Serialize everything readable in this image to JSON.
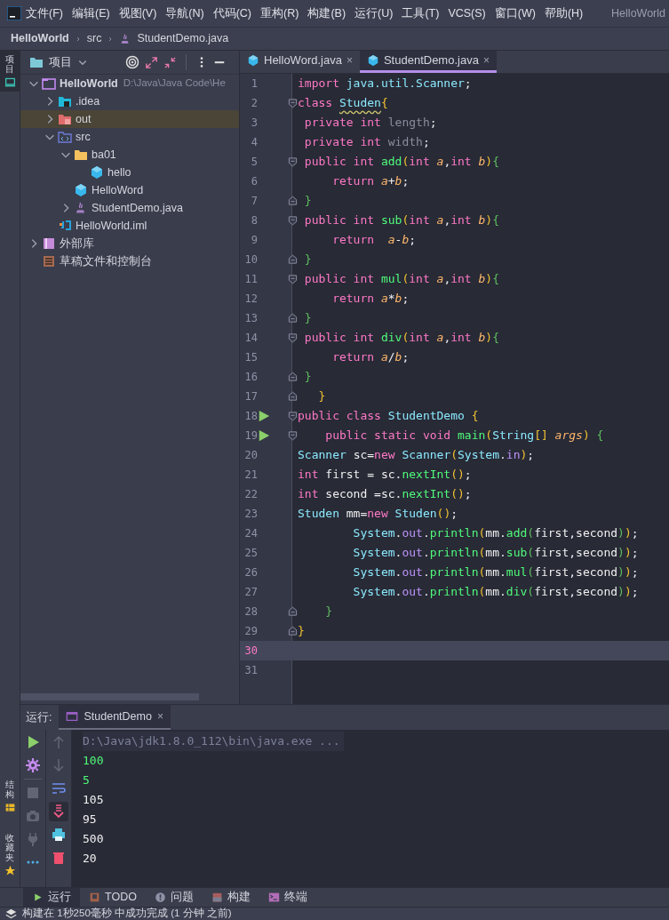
{
  "menu": {
    "items": [
      "文件(F)",
      "编辑(E)",
      "视图(V)",
      "导航(N)",
      "代码(C)",
      "重构(R)",
      "构建(B)",
      "运行(U)",
      "工具(T)",
      "VCS(S)",
      "窗口(W)",
      "帮助(H)"
    ],
    "title": "HelloWorld"
  },
  "breadcrumb": [
    {
      "text": "HelloWorld",
      "kind": "project"
    },
    {
      "text": "src",
      "kind": "folder"
    },
    {
      "text": "StudentDemo.java",
      "kind": "java"
    }
  ],
  "side_strip": [
    {
      "label": "项目",
      "kind": "project",
      "selected": true
    },
    {
      "label": "结构",
      "kind": "structure",
      "selected": false
    },
    {
      "label": "收藏夹",
      "kind": "favorites",
      "selected": false
    }
  ],
  "project_panel": {
    "title": "项目",
    "tree": [
      {
        "label": "HelloWorld",
        "path": "D:\\Java\\Java Code\\He",
        "kind": "module",
        "expanded": true,
        "selected": false,
        "children": [
          {
            "label": ".idea",
            "kind": "idea",
            "expanded": false,
            "selected": false
          },
          {
            "label": "out",
            "kind": "excluded",
            "expanded": false,
            "selected": true
          },
          {
            "label": "src",
            "kind": "source",
            "expanded": true,
            "selected": false,
            "children": [
              {
                "label": "ba01",
                "kind": "package",
                "expanded": true,
                "selected": false,
                "children": [
                  {
                    "label": "hello",
                    "kind": "class",
                    "selected": false
                  }
                ]
              },
              {
                "label": "HelloWord",
                "kind": "class",
                "selected": false
              },
              {
                "label": "StudentDemo.java",
                "kind": "java",
                "expanded": false,
                "selected": false
              }
            ]
          },
          {
            "label": "HelloWorld.iml",
            "kind": "iml",
            "selected": false
          }
        ]
      },
      {
        "label": "外部库",
        "kind": "library",
        "expanded": false,
        "selected": false
      },
      {
        "label": "草稿文件和控制台",
        "kind": "scratch",
        "selected": false
      }
    ]
  },
  "editor": {
    "tabs": [
      {
        "label": "HelloWord.java",
        "close": "×",
        "selected": false
      },
      {
        "label": "StudentDemo.java",
        "close": "×",
        "selected": true
      }
    ],
    "lines": [
      {
        "number": "1",
        "run": false,
        "fold_open": false,
        "fold_close": false,
        "current": false,
        "tokens": [
          {
            "kind": "kw",
            "text": "import "
          },
          {
            "kind": "type",
            "text": "java.util.Scanner"
          },
          {
            "kind": "plain",
            "text": ";"
          }
        ]
      },
      {
        "number": "2",
        "run": false,
        "fold_open": true,
        "fold_close": false,
        "current": false,
        "tokens": [
          {
            "kind": "kw",
            "text": "class "
          },
          {
            "kind": "type",
            "text": "Studen",
            "warn": true
          },
          {
            "kind": "b1",
            "text": "{"
          }
        ]
      },
      {
        "number": "3",
        "run": false,
        "fold_open": false,
        "fold_close": false,
        "current": false,
        "tokens": [
          {
            "kind": "kw",
            "text": " private int "
          },
          {
            "kind": "unused",
            "text": "length"
          },
          {
            "kind": "plain",
            "text": ";"
          }
        ]
      },
      {
        "number": "4",
        "run": false,
        "fold_open": false,
        "fold_close": false,
        "current": false,
        "tokens": [
          {
            "kind": "kw",
            "text": " private int "
          },
          {
            "kind": "unused",
            "text": "width"
          },
          {
            "kind": "plain",
            "text": ";"
          }
        ]
      },
      {
        "number": "5",
        "run": false,
        "fold_open": true,
        "fold_close": false,
        "current": false,
        "tokens": [
          {
            "kind": "kw",
            "text": " public int "
          },
          {
            "kind": "method",
            "text": "add"
          },
          {
            "kind": "b1",
            "text": "("
          },
          {
            "kind": "kw",
            "text": "int "
          },
          {
            "kind": "param",
            "text": "a"
          },
          {
            "kind": "plain",
            "text": ","
          },
          {
            "kind": "kw",
            "text": "int "
          },
          {
            "kind": "param",
            "text": "b"
          },
          {
            "kind": "b1",
            "text": ")"
          },
          {
            "kind": "b2",
            "text": "{"
          }
        ]
      },
      {
        "number": "6",
        "run": false,
        "fold_open": false,
        "fold_close": false,
        "current": false,
        "tokens": [
          {
            "kind": "kw",
            "text": "     return "
          },
          {
            "kind": "param",
            "text": "a"
          },
          {
            "kind": "plain",
            "text": "+"
          },
          {
            "kind": "param",
            "text": "b"
          },
          {
            "kind": "plain",
            "text": ";"
          }
        ]
      },
      {
        "number": "7",
        "run": false,
        "fold_open": false,
        "fold_close": true,
        "current": false,
        "tokens": [
          {
            "kind": "b2",
            "text": " }"
          }
        ]
      },
      {
        "number": "8",
        "run": false,
        "fold_open": true,
        "fold_close": false,
        "current": false,
        "tokens": [
          {
            "kind": "kw",
            "text": " public int "
          },
          {
            "kind": "method",
            "text": "sub"
          },
          {
            "kind": "b1",
            "text": "("
          },
          {
            "kind": "kw",
            "text": "int "
          },
          {
            "kind": "param",
            "text": "a"
          },
          {
            "kind": "plain",
            "text": ","
          },
          {
            "kind": "kw",
            "text": "int "
          },
          {
            "kind": "param",
            "text": "b"
          },
          {
            "kind": "b1",
            "text": ")"
          },
          {
            "kind": "b2",
            "text": "{"
          }
        ]
      },
      {
        "number": "9",
        "run": false,
        "fold_open": false,
        "fold_close": false,
        "current": false,
        "tokens": [
          {
            "kind": "kw",
            "text": "     return  "
          },
          {
            "kind": "param",
            "text": "a"
          },
          {
            "kind": "plain",
            "text": "-"
          },
          {
            "kind": "param",
            "text": "b"
          },
          {
            "kind": "plain",
            "text": ";"
          }
        ]
      },
      {
        "number": "10",
        "run": false,
        "fold_open": false,
        "fold_close": true,
        "current": false,
        "tokens": [
          {
            "kind": "b2",
            "text": " }"
          }
        ]
      },
      {
        "number": "11",
        "run": false,
        "fold_open": true,
        "fold_close": false,
        "current": false,
        "tokens": [
          {
            "kind": "kw",
            "text": " public int "
          },
          {
            "kind": "method",
            "text": "mul"
          },
          {
            "kind": "b1",
            "text": "("
          },
          {
            "kind": "kw",
            "text": "int "
          },
          {
            "kind": "param",
            "text": "a"
          },
          {
            "kind": "plain",
            "text": ","
          },
          {
            "kind": "kw",
            "text": "int "
          },
          {
            "kind": "param",
            "text": "b"
          },
          {
            "kind": "b1",
            "text": ")"
          },
          {
            "kind": "b2",
            "text": "{"
          }
        ]
      },
      {
        "number": "12",
        "run": false,
        "fold_open": false,
        "fold_close": false,
        "current": false,
        "tokens": [
          {
            "kind": "kw",
            "text": "     return "
          },
          {
            "kind": "param",
            "text": "a"
          },
          {
            "kind": "plain",
            "text": "*"
          },
          {
            "kind": "param",
            "text": "b"
          },
          {
            "kind": "plain",
            "text": ";"
          }
        ]
      },
      {
        "number": "13",
        "run": false,
        "fold_open": false,
        "fold_close": true,
        "current": false,
        "tokens": [
          {
            "kind": "b2",
            "text": " }"
          }
        ]
      },
      {
        "number": "14",
        "run": false,
        "fold_open": true,
        "fold_close": false,
        "current": false,
        "tokens": [
          {
            "kind": "kw",
            "text": " public int "
          },
          {
            "kind": "method",
            "text": "div"
          },
          {
            "kind": "b1",
            "text": "("
          },
          {
            "kind": "kw",
            "text": "int "
          },
          {
            "kind": "param",
            "text": "a"
          },
          {
            "kind": "plain",
            "text": ","
          },
          {
            "kind": "kw",
            "text": "int "
          },
          {
            "kind": "param",
            "text": "b"
          },
          {
            "kind": "b1",
            "text": ")"
          },
          {
            "kind": "b2",
            "text": "{"
          }
        ]
      },
      {
        "number": "15",
        "run": false,
        "fold_open": false,
        "fold_close": false,
        "current": false,
        "tokens": [
          {
            "kind": "kw",
            "text": "     return "
          },
          {
            "kind": "param",
            "text": "a"
          },
          {
            "kind": "plain",
            "text": "/"
          },
          {
            "kind": "param",
            "text": "b"
          },
          {
            "kind": "plain",
            "text": ";"
          }
        ]
      },
      {
        "number": "16",
        "run": false,
        "fold_open": false,
        "fold_close": true,
        "current": false,
        "tokens": [
          {
            "kind": "b2",
            "text": " }"
          }
        ]
      },
      {
        "number": "17",
        "run": false,
        "fold_open": false,
        "fold_close": true,
        "current": false,
        "tokens": [
          {
            "kind": "b1",
            "text": "   }"
          }
        ]
      },
      {
        "number": "18",
        "run": true,
        "fold_open": true,
        "fold_close": false,
        "current": false,
        "tokens": [
          {
            "kind": "kw",
            "text": "public class "
          },
          {
            "kind": "type",
            "text": "StudentDemo "
          },
          {
            "kind": "b1",
            "text": "{"
          }
        ]
      },
      {
        "number": "19",
        "run": true,
        "fold_open": true,
        "fold_close": false,
        "current": false,
        "tokens": [
          {
            "kind": "kw",
            "text": "    public static void "
          },
          {
            "kind": "method",
            "text": "main"
          },
          {
            "kind": "b1",
            "text": "("
          },
          {
            "kind": "type",
            "text": "String"
          },
          {
            "kind": "b1",
            "text": "[] "
          },
          {
            "kind": "param",
            "text": "args"
          },
          {
            "kind": "b1",
            "text": ") "
          },
          {
            "kind": "b2",
            "text": "{"
          }
        ]
      },
      {
        "number": "20",
        "run": false,
        "fold_open": false,
        "fold_close": false,
        "current": false,
        "tokens": [
          {
            "kind": "type",
            "text": "Scanner "
          },
          {
            "kind": "plain",
            "text": "sc="
          },
          {
            "kind": "kw",
            "text": "new "
          },
          {
            "kind": "type",
            "text": "Scanner"
          },
          {
            "kind": "b1",
            "text": "("
          },
          {
            "kind": "type",
            "text": "System"
          },
          {
            "kind": "plain",
            "text": "."
          },
          {
            "kind": "static",
            "text": "in"
          },
          {
            "kind": "b1",
            "text": ")"
          },
          {
            "kind": "plain",
            "text": ";"
          }
        ]
      },
      {
        "number": "21",
        "run": false,
        "fold_open": false,
        "fold_close": false,
        "current": false,
        "tokens": [
          {
            "kind": "kw",
            "text": "int "
          },
          {
            "kind": "plain",
            "text": "first = sc."
          },
          {
            "kind": "method",
            "text": "nextInt"
          },
          {
            "kind": "b1",
            "text": "()"
          },
          {
            "kind": "plain",
            "text": ";"
          }
        ]
      },
      {
        "number": "22",
        "run": false,
        "fold_open": false,
        "fold_close": false,
        "current": false,
        "tokens": [
          {
            "kind": "kw",
            "text": "int "
          },
          {
            "kind": "plain",
            "text": "second =sc."
          },
          {
            "kind": "method",
            "text": "nextInt"
          },
          {
            "kind": "b1",
            "text": "()"
          },
          {
            "kind": "plain",
            "text": ";"
          }
        ]
      },
      {
        "number": "23",
        "run": false,
        "fold_open": false,
        "fold_close": false,
        "current": false,
        "tokens": [
          {
            "kind": "type",
            "text": "Studen "
          },
          {
            "kind": "plain",
            "text": "mm="
          },
          {
            "kind": "kw",
            "text": "new "
          },
          {
            "kind": "type",
            "text": "Studen"
          },
          {
            "kind": "b1",
            "text": "()"
          },
          {
            "kind": "plain",
            "text": ";"
          }
        ]
      },
      {
        "number": "24",
        "run": false,
        "fold_open": false,
        "fold_close": false,
        "current": false,
        "tokens": [
          {
            "kind": "type",
            "text": "        System"
          },
          {
            "kind": "plain",
            "text": "."
          },
          {
            "kind": "static",
            "text": "out"
          },
          {
            "kind": "plain",
            "text": "."
          },
          {
            "kind": "method",
            "text": "println"
          },
          {
            "kind": "b1",
            "text": "("
          },
          {
            "kind": "plain",
            "text": "mm."
          },
          {
            "kind": "method",
            "text": "add"
          },
          {
            "kind": "b2",
            "text": "("
          },
          {
            "kind": "plain",
            "text": "first,second"
          },
          {
            "kind": "b2",
            "text": ")"
          },
          {
            "kind": "b1",
            "text": ")"
          },
          {
            "kind": "plain",
            "text": ";"
          }
        ]
      },
      {
        "number": "25",
        "run": false,
        "fold_open": false,
        "fold_close": false,
        "current": false,
        "tokens": [
          {
            "kind": "type",
            "text": "        System"
          },
          {
            "kind": "plain",
            "text": "."
          },
          {
            "kind": "static",
            "text": "out"
          },
          {
            "kind": "plain",
            "text": "."
          },
          {
            "kind": "method",
            "text": "println"
          },
          {
            "kind": "b1",
            "text": "("
          },
          {
            "kind": "plain",
            "text": "mm."
          },
          {
            "kind": "method",
            "text": "sub"
          },
          {
            "kind": "b2",
            "text": "("
          },
          {
            "kind": "plain",
            "text": "first,second"
          },
          {
            "kind": "b2",
            "text": ")"
          },
          {
            "kind": "b1",
            "text": ")"
          },
          {
            "kind": "plain",
            "text": ";"
          }
        ]
      },
      {
        "number": "26",
        "run": false,
        "fold_open": false,
        "fold_close": false,
        "current": false,
        "tokens": [
          {
            "kind": "type",
            "text": "        System"
          },
          {
            "kind": "plain",
            "text": "."
          },
          {
            "kind": "static",
            "text": "out"
          },
          {
            "kind": "plain",
            "text": "."
          },
          {
            "kind": "method",
            "text": "println"
          },
          {
            "kind": "b1",
            "text": "("
          },
          {
            "kind": "plain",
            "text": "mm."
          },
          {
            "kind": "method",
            "text": "mul"
          },
          {
            "kind": "b2",
            "text": "("
          },
          {
            "kind": "plain",
            "text": "first,second"
          },
          {
            "kind": "b2",
            "text": ")"
          },
          {
            "kind": "b1",
            "text": ")"
          },
          {
            "kind": "plain",
            "text": ";"
          }
        ]
      },
      {
        "number": "27",
        "run": false,
        "fold_open": false,
        "fold_close": false,
        "current": false,
        "tokens": [
          {
            "kind": "type",
            "text": "        System"
          },
          {
            "kind": "plain",
            "text": "."
          },
          {
            "kind": "static",
            "text": "out"
          },
          {
            "kind": "plain",
            "text": "."
          },
          {
            "kind": "method",
            "text": "println"
          },
          {
            "kind": "b1",
            "text": "("
          },
          {
            "kind": "plain",
            "text": "mm."
          },
          {
            "kind": "method",
            "text": "div"
          },
          {
            "kind": "b2",
            "text": "("
          },
          {
            "kind": "plain",
            "text": "first,second"
          },
          {
            "kind": "b2",
            "text": ")"
          },
          {
            "kind": "b1",
            "text": ")"
          },
          {
            "kind": "plain",
            "text": ";"
          }
        ]
      },
      {
        "number": "28",
        "run": false,
        "fold_open": false,
        "fold_close": true,
        "current": false,
        "tokens": [
          {
            "kind": "b2",
            "text": "    }"
          }
        ]
      },
      {
        "number": "29",
        "run": false,
        "fold_open": false,
        "fold_close": true,
        "current": false,
        "tokens": [
          {
            "kind": "b1",
            "text": "}"
          }
        ]
      },
      {
        "number": "30",
        "run": false,
        "fold_open": false,
        "fold_close": false,
        "current": true
      },
      {
        "number": "31",
        "run": false,
        "fold_open": false,
        "fold_close": false,
        "current": false
      }
    ]
  },
  "run_panel": {
    "label": "运行:",
    "tab": {
      "label": "StudentDemo",
      "close": "×"
    },
    "tools_left": [
      {
        "kind": "run",
        "disabled": false
      },
      {
        "kind": "settings",
        "disabled": false
      },
      {
        "kind": "stop",
        "disabled": true
      },
      {
        "kind": "camera",
        "disabled": true
      },
      {
        "kind": "plug",
        "disabled": true
      },
      {
        "kind": "more",
        "disabled": false
      }
    ],
    "tools_right": [
      {
        "kind": "up",
        "disabled": true,
        "selected": false
      },
      {
        "kind": "down",
        "disabled": true,
        "selected": false
      },
      {
        "kind": "wrap",
        "disabled": false,
        "selected": false
      },
      {
        "kind": "scroll-end",
        "disabled": false,
        "selected": true
      },
      {
        "kind": "print",
        "disabled": false,
        "selected": false
      },
      {
        "kind": "delete",
        "disabled": false,
        "selected": false
      }
    ],
    "console": [
      {
        "kind": "command",
        "text": "D:\\Java\\jdk1.8.0_112\\bin\\java.exe ..."
      },
      {
        "kind": "input",
        "text": "100"
      },
      {
        "kind": "input",
        "text": "5"
      },
      {
        "kind": "output",
        "text": "105"
      },
      {
        "kind": "output",
        "text": "95"
      },
      {
        "kind": "output",
        "text": "500"
      },
      {
        "kind": "output",
        "text": "20"
      }
    ]
  },
  "tool_tabs": [
    {
      "label": "运行",
      "kind": "run",
      "selected": true
    },
    {
      "label": "TODO",
      "kind": "todo",
      "selected": false
    },
    {
      "label": "问题",
      "kind": "problems",
      "selected": false
    },
    {
      "label": "构建",
      "kind": "build",
      "selected": false
    },
    {
      "label": "终端",
      "kind": "terminal",
      "selected": false
    }
  ],
  "status_bar": {
    "text": "构建在 1秒250毫秒 中成功完成 (1 分钟 之前)"
  }
}
